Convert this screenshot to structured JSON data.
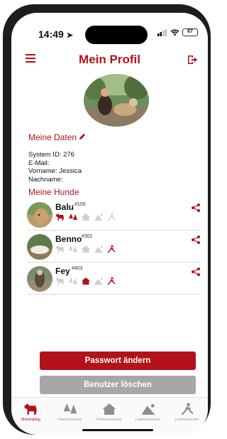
{
  "status_bar": {
    "time": "14:49",
    "battery": "67"
  },
  "header": {
    "title": "Mein Profil"
  },
  "my_data": {
    "title": "Meine Daten",
    "lines": [
      "System ID: 276",
      "E-Mail:",
      "Vorname: Jessica",
      "Nachname:"
    ]
  },
  "my_dogs": {
    "title": "Meine Hunde",
    "dogs": [
      {
        "name": "Balu",
        "id": "#155"
      },
      {
        "name": "Benno",
        "id": "#301"
      },
      {
        "name": "Fey",
        "id": "#403"
      }
    ]
  },
  "buttons": {
    "change_password": "Passwort ändern",
    "delete_user": "Benutzer löschen"
  },
  "tabs": [
    {
      "label": "Mantrailing",
      "icon": "dog-icon",
      "active": true
    },
    {
      "label": "Flächensuche",
      "icon": "trees-icon",
      "active": false
    },
    {
      "label": "Trümmersuche",
      "icon": "house-icon",
      "active": false
    },
    {
      "label": "Lawinensuche",
      "icon": "avalanche-icon",
      "active": false
    },
    {
      "label": "Leichensuche",
      "icon": "person-icon",
      "active": false
    }
  ],
  "colors": {
    "accent": "#b3121a",
    "muted": "#cfcfcf",
    "button_grey": "#a7a7a7"
  }
}
